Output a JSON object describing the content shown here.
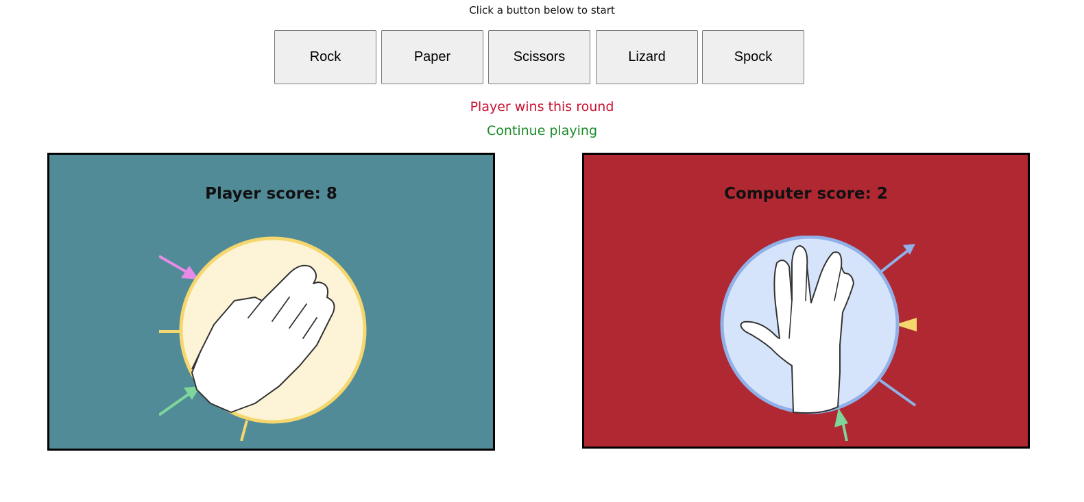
{
  "header": {
    "instruction": "Click a button below to start"
  },
  "choices": [
    {
      "label": "Rock"
    },
    {
      "label": "Paper"
    },
    {
      "label": "Scissors"
    },
    {
      "label": "Lizard"
    },
    {
      "label": "Spock"
    }
  ],
  "result": {
    "round_message": "Player wins this round",
    "status_message": "Continue playing"
  },
  "player": {
    "score_text": "Player score: 8",
    "panel_color": "#528b98",
    "choice_icon": "paper-hand-icon"
  },
  "computer": {
    "score_text": "Computer score: 2",
    "panel_color": "#b02832",
    "choice_icon": "spock-hand-icon"
  },
  "colors": {
    "round_message": "#c8102e",
    "status_message": "#1a8a2a"
  }
}
